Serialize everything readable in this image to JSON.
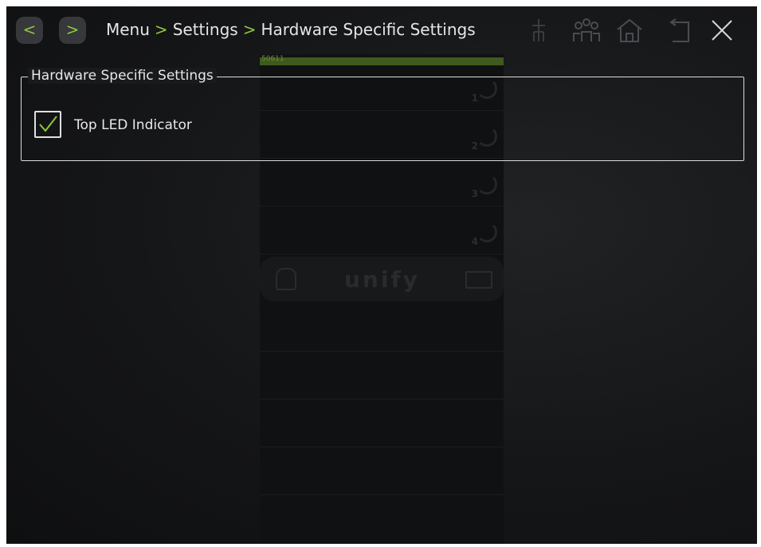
{
  "header": {
    "back_label": "<",
    "forward_label": ">",
    "breadcrumb": {
      "item1": "Menu",
      "sep1": ">",
      "item2": "Settings",
      "sep2": ">",
      "item3": "Hardware Specific Settings"
    },
    "icons": [
      "network-icon",
      "contacts-icon",
      "home-icon",
      "back-arrow-icon",
      "close-icon"
    ]
  },
  "group": {
    "title": "Hardware Specific Settings",
    "options": [
      {
        "label": "Top LED Indicator",
        "checked": true
      }
    ]
  },
  "background": {
    "strip_label": "50611",
    "line_numbers": [
      "1",
      "2",
      "3",
      "4"
    ],
    "brand": "unify"
  },
  "colors": {
    "accent": "#8dc63f",
    "background": "#151618",
    "text": "#e8e8e8"
  }
}
